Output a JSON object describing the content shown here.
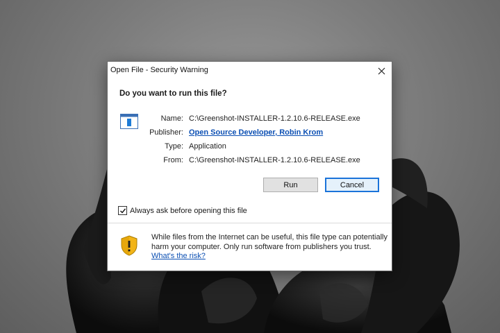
{
  "dialog": {
    "title": "Open File - Security Warning",
    "question": "Do you want to run this file?",
    "fields": {
      "name_label": "Name:",
      "name_value": "C:\\Greenshot-INSTALLER-1.2.10.6-RELEASE.exe",
      "publisher_label": "Publisher:",
      "publisher_value": "Open Source Developer, Robin Krom",
      "type_label": "Type:",
      "type_value": "Application",
      "from_label": "From:",
      "from_value": "C:\\Greenshot-INSTALLER-1.2.10.6-RELEASE.exe"
    },
    "buttons": {
      "run": "Run",
      "cancel": "Cancel"
    },
    "checkbox": {
      "label": "Always ask before opening this file",
      "checked": true
    },
    "warning": {
      "text": "While files from the Internet can be useful, this file type can potentially harm your computer. Only run software from publishers you trust.",
      "link": "What's the risk?"
    }
  },
  "colors": {
    "link": "#0b4fb3",
    "focus_border": "#1a73d9",
    "shield_yellow": "#f2b418"
  },
  "icons": [
    "close-icon",
    "application-icon",
    "checkmark-icon",
    "warning-shield-icon"
  ]
}
